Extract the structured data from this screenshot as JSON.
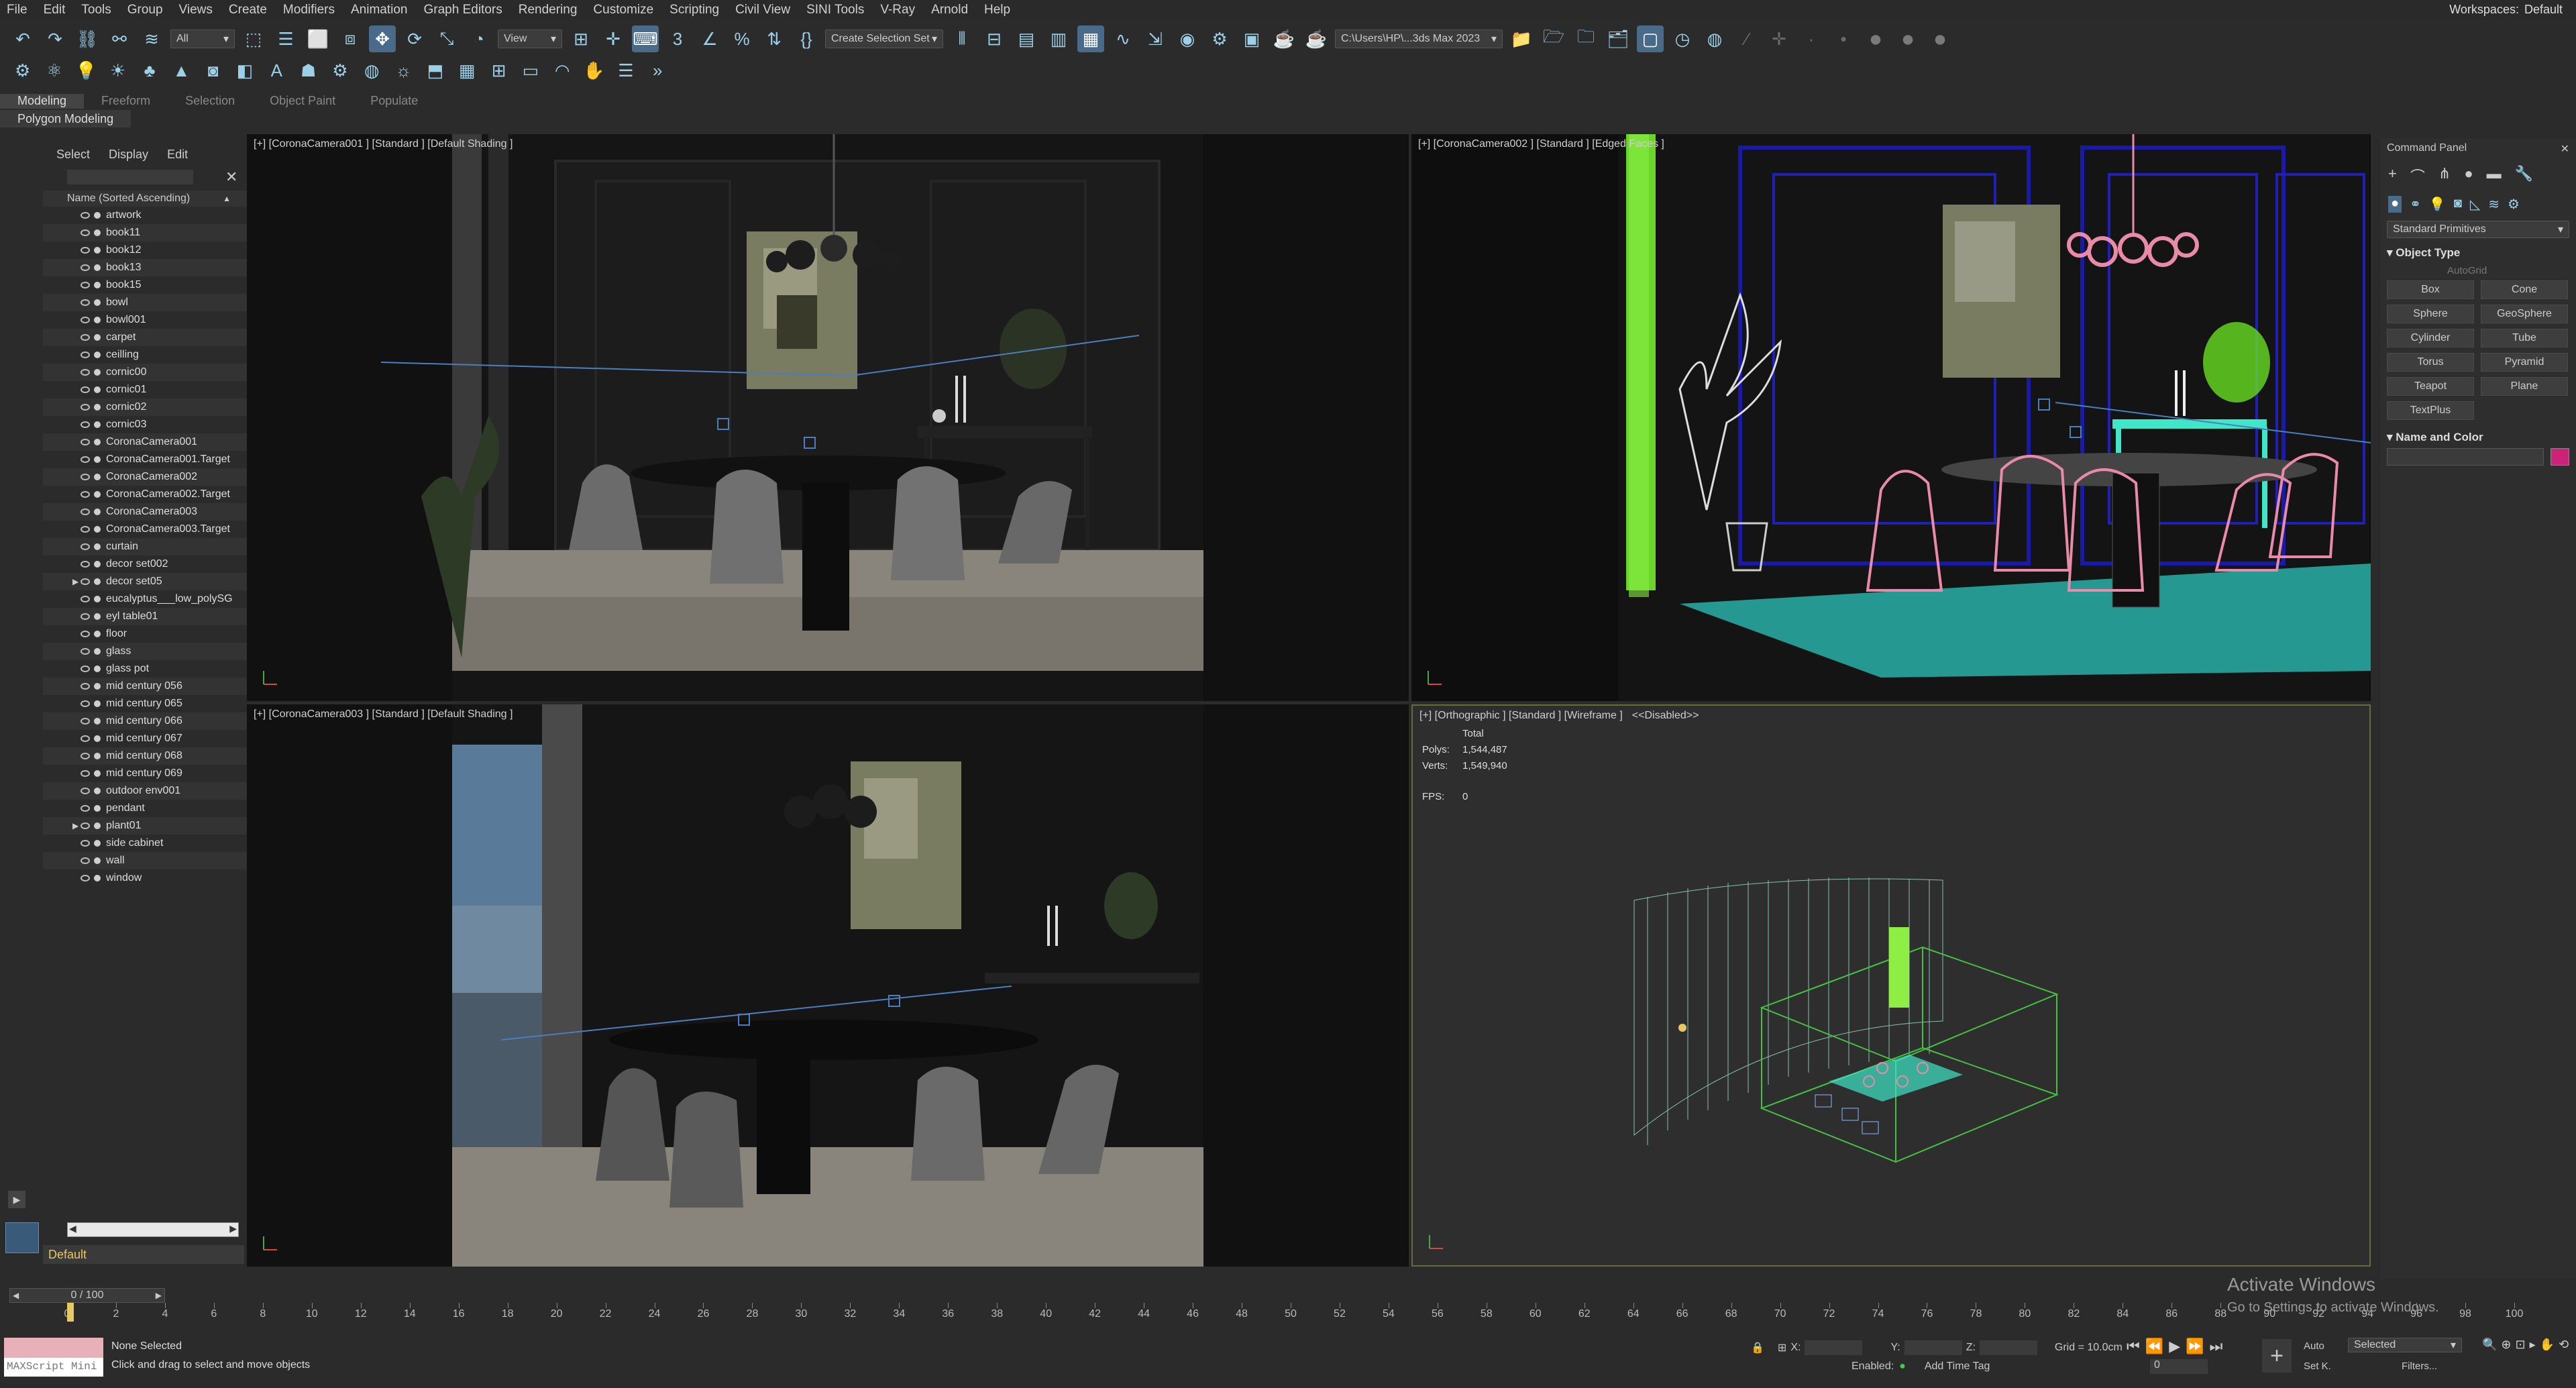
{
  "menu": [
    "File",
    "Edit",
    "Tools",
    "Group",
    "Views",
    "Create",
    "Modifiers",
    "Animation",
    "Graph Editors",
    "Rendering",
    "Customize",
    "Scripting",
    "Civil View",
    "SINI Tools",
    "V-Ray",
    "Arnold",
    "Help"
  ],
  "workspaces": {
    "label": "Workspaces:",
    "value": "Default"
  },
  "toolbar": {
    "selection_filter": "All",
    "ref_coord": "View",
    "selection_set": "Create Selection Set",
    "project_path": "C:\\Users\\HP\\...3ds Max 2023"
  },
  "ribbon": {
    "tabs": [
      "Modeling",
      "Freeform",
      "Selection",
      "Object Paint",
      "Populate"
    ],
    "active": "Modeling",
    "sub": "Polygon Modeling"
  },
  "scene_explorer": {
    "tabs": [
      "Select",
      "Display",
      "Edit"
    ],
    "header": "Name (Sorted Ascending)",
    "items": [
      "artwork",
      "book11",
      "book12",
      "book13",
      "book15",
      "bowl",
      "bowl001",
      "carpet",
      "ceilling",
      "cornic00",
      "cornic01",
      "cornic02",
      "cornic03",
      "CoronaCamera001",
      "CoronaCamera001.Target",
      "CoronaCamera002",
      "CoronaCamera002.Target",
      "CoronaCamera003",
      "CoronaCamera003.Target",
      "curtain",
      "decor set002",
      "decor set05",
      "eucalyptus___low_polySG",
      "eyl table01",
      "floor",
      "glass",
      "glass pot",
      "mid century 056",
      "mid century 065",
      "mid century 066",
      "mid century 067",
      "mid century 068",
      "mid century 069",
      "outdoor env001",
      "pendant",
      "plant01",
      "side cabinet",
      "wall",
      "window"
    ],
    "layer": "Default"
  },
  "viewports": {
    "top_left": "[+] [CoronaCamera001 ] [Standard ] [Default Shading ]",
    "top_right": "[+] [CoronaCamera002 ] [Standard ] [Edged Faces ]",
    "bottom_left": "[+] [CoronaCamera003 ] [Standard ] [Default Shading ]",
    "bottom_right": "[+] [Orthographic ] [Standard ] [Wireframe ]",
    "bottom_right_disabled": "<<Disabled>>",
    "stats": {
      "total_label": "Total",
      "polys_label": "Polys:",
      "polys": "1,544,487",
      "verts_label": "Verts:",
      "verts": "1,549,940",
      "fps_label": "FPS:",
      "fps": "0"
    }
  },
  "command_panel": {
    "title": "Command Panel",
    "category": "Standard Primitives",
    "object_type_title": "Object Type",
    "autogrid": "AutoGrid",
    "buttons": [
      "Box",
      "Cone",
      "Sphere",
      "GeoSphere",
      "Cylinder",
      "Tube",
      "Torus",
      "Pyramid",
      "Teapot",
      "Plane",
      "TextPlus"
    ],
    "name_color_title": "Name and Color",
    "color": "#cc2277"
  },
  "timeline": {
    "frame": "0 / 100",
    "ticks": [
      "0",
      "2",
      "4",
      "6",
      "8",
      "10",
      "12",
      "14",
      "16",
      "18",
      "20",
      "22",
      "24",
      "26",
      "28",
      "30",
      "32",
      "34",
      "36",
      "38",
      "40",
      "42",
      "44",
      "46",
      "48",
      "50",
      "52",
      "54",
      "56",
      "58",
      "60",
      "62",
      "64",
      "66",
      "68",
      "70",
      "72",
      "74",
      "76",
      "78",
      "80",
      "82",
      "84",
      "86",
      "88",
      "90",
      "92",
      "94",
      "96",
      "98",
      "100"
    ]
  },
  "status": {
    "maxscript": "MAXScript Mini",
    "selection": "None Selected",
    "prompt": "Click and drag to select and move objects",
    "x_label": "X:",
    "y_label": "Y:",
    "z_label": "Z:",
    "grid": "Grid = 10.0cm",
    "enabled": "Enabled:",
    "add_time_tag": "Add Time Tag",
    "auto": "Auto",
    "set_key": "Set K.",
    "key_mode": "Selected",
    "filters": "Filters...",
    "frame_value": "0"
  },
  "watermark": {
    "line1": "Activate Windows",
    "line2": "Go to Settings to activate Windows."
  }
}
